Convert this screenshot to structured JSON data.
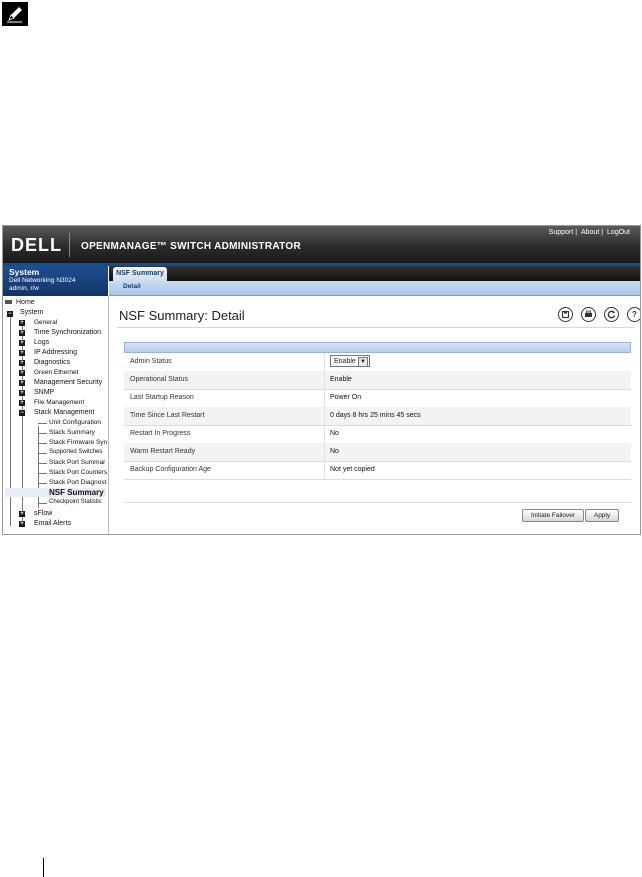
{
  "header": {
    "logo": "DELL",
    "app_title": "OPENMANAGE™ SWITCH ADMINISTRATOR",
    "links": [
      "Support",
      "About",
      "LogOut"
    ]
  },
  "sidebar": {
    "title": "System",
    "device": "Dell Networking N3024",
    "user": "admin, r/w",
    "tree": [
      {
        "label": "Home"
      },
      {
        "label": "System"
      },
      {
        "label": "General"
      },
      {
        "label": "Time Synchronization"
      },
      {
        "label": "Logs"
      },
      {
        "label": "IP Addressing"
      },
      {
        "label": "Diagnostics"
      },
      {
        "label": "Green Ethernet"
      },
      {
        "label": "Management Security"
      },
      {
        "label": "SNMP"
      },
      {
        "label": "File Management"
      },
      {
        "label": "Stack Management"
      },
      {
        "label": "Unit Configuration"
      },
      {
        "label": "Stack Summary"
      },
      {
        "label": "Stack Firmware Syn"
      },
      {
        "label": "Supported Switches"
      },
      {
        "label": "Stack Port Summar"
      },
      {
        "label": "Stack Port Counters"
      },
      {
        "label": "Stack Port Diagnost"
      },
      {
        "label": "NSF Summary"
      },
      {
        "label": "Checkpoint Statistic"
      },
      {
        "label": "sFlow"
      },
      {
        "label": "Email Alerts"
      }
    ]
  },
  "tabs": {
    "main": "NSF Summary",
    "sub": "Detail"
  },
  "page": {
    "title": "NSF Summary: Detail",
    "rows": [
      {
        "label": "Admin Status",
        "value": "Enable"
      },
      {
        "label": "Operational Status",
        "value": "Enable"
      },
      {
        "label": "Last Startup Reason",
        "value": "Power On"
      },
      {
        "label": "Time Since Last Restart",
        "value": "0 days 8 hrs 25 mins 45 secs"
      },
      {
        "label": "Restart In Progress",
        "value": "No"
      },
      {
        "label": "Warm Restart Ready",
        "value": "No"
      },
      {
        "label": "Backup Configuration Age",
        "value": "Not yet copied"
      }
    ],
    "buttons": {
      "failover": "Initiate Failover",
      "apply": "Apply"
    }
  }
}
